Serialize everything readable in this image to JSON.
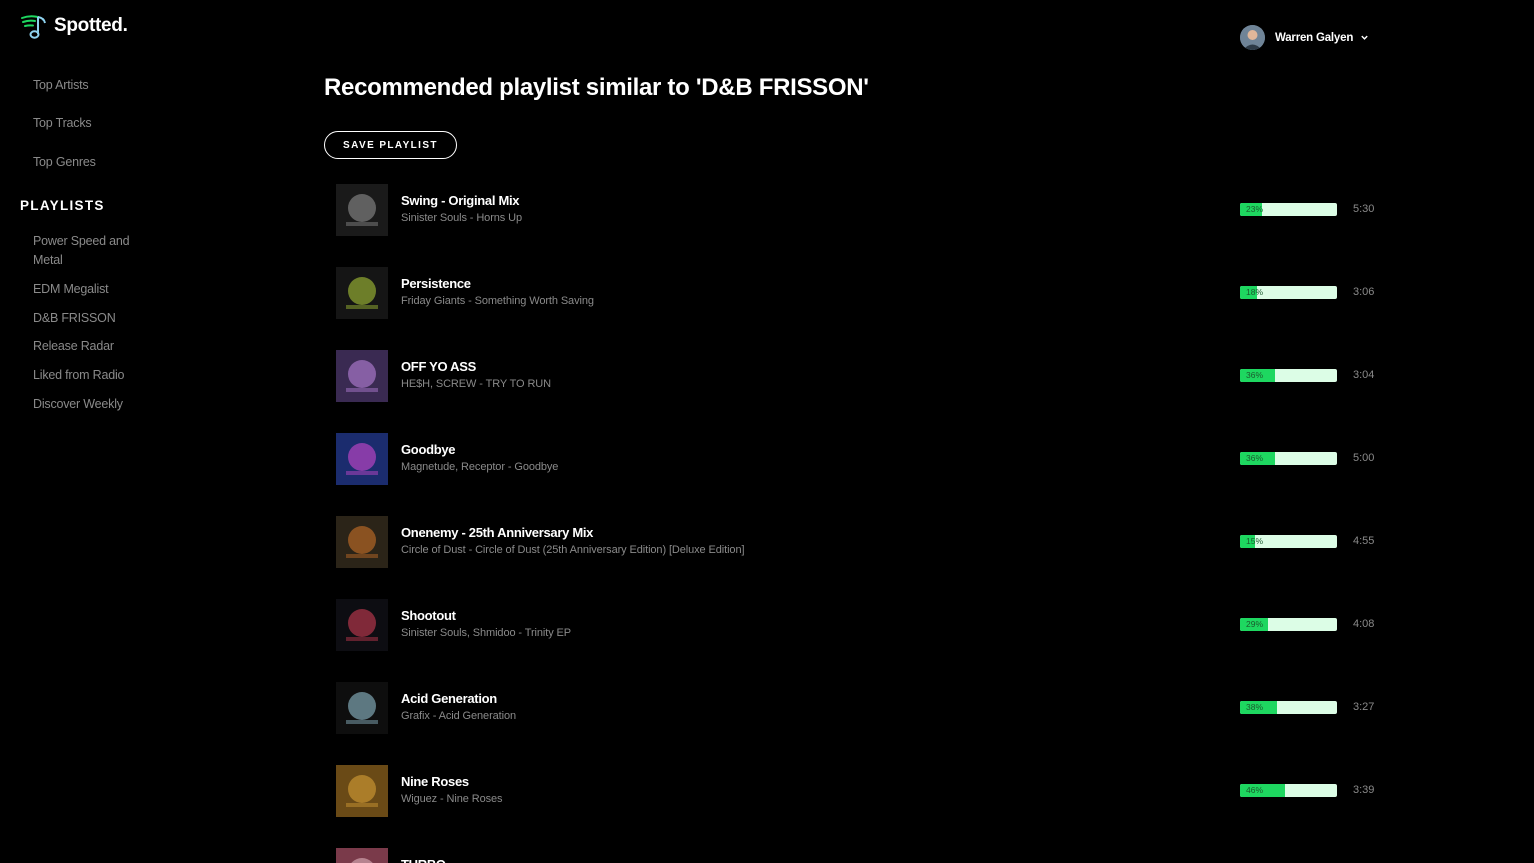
{
  "app": {
    "name": "Spotted."
  },
  "user": {
    "name": "Warren Galyen"
  },
  "sidebar": {
    "links": [
      "Top Artists",
      "Top Tracks",
      "Top Genres"
    ],
    "playlists_heading": "PLAYLISTS",
    "playlists": [
      "Power Speed and Metal",
      "EDM Megalist",
      "D&B FRISSON",
      "Release Radar",
      "Liked from Radio",
      "Discover Weekly"
    ]
  },
  "main": {
    "title": "Recommended playlist similar to 'D&B FRISSON'",
    "save_label": "SAVE PLAYLIST",
    "tracks": [
      {
        "name": "Swing - Original Mix",
        "subtitle": "Sinister Souls - Horns Up",
        "popularity": 23,
        "popularity_label": "23%",
        "duration": "5:30",
        "cover_colors": [
          "#1a1a1a",
          "#9a9a9a"
        ]
      },
      {
        "name": "Persistence",
        "subtitle": "Friday Giants - Something Worth Saving",
        "popularity": 18,
        "popularity_label": "18%",
        "duration": "3:06",
        "cover_colors": [
          "#151515",
          "#b7d63a"
        ]
      },
      {
        "name": "OFF YO ASS",
        "subtitle": "HE$H, SCREW - TRY TO RUN",
        "popularity": 36,
        "popularity_label": "36%",
        "duration": "3:04",
        "cover_colors": [
          "#3a2a52",
          "#c58ae8"
        ]
      },
      {
        "name": "Goodbye",
        "subtitle": "Magnetude, Receptor - Goodbye",
        "popularity": 36,
        "popularity_label": "36%",
        "duration": "5:00",
        "cover_colors": [
          "#1b2c6e",
          "#e04ad8"
        ]
      },
      {
        "name": "Onenemy - 25th Anniversary Mix",
        "subtitle": "Circle of Dust - Circle of Dust (25th Anniversary Edition) [Deluxe Edition]",
        "popularity": 15,
        "popularity_label": "15%",
        "duration": "4:55",
        "cover_colors": [
          "#2b2418",
          "#d9792a"
        ]
      },
      {
        "name": "Shootout",
        "subtitle": "Sinister Souls, Shmidoo - Trinity EP",
        "popularity": 29,
        "popularity_label": "29%",
        "duration": "4:08",
        "cover_colors": [
          "#0d0d12",
          "#e0425a"
        ]
      },
      {
        "name": "Acid Generation",
        "subtitle": "Grafix - Acid Generation",
        "popularity": 38,
        "popularity_label": "38%",
        "duration": "3:27",
        "cover_colors": [
          "#0e0e0e",
          "#9fd0e0"
        ]
      },
      {
        "name": "Nine Roses",
        "subtitle": "Wiguez - Nine Roses",
        "popularity": 46,
        "popularity_label": "46%",
        "duration": "3:39",
        "cover_colors": [
          "#6a4a16",
          "#e0a83a"
        ]
      },
      {
        "name": "TURBO",
        "subtitle": "",
        "popularity": 0,
        "popularity_label": "",
        "duration": "",
        "cover_colors": [
          "#7a3a4a",
          "#e8c0c8"
        ]
      }
    ]
  },
  "colors": {
    "accent": "#1ed760",
    "bar_track": "#dcfde6",
    "muted_text": "#8a8a8a",
    "background": "#000000"
  },
  "icons": {
    "logo": "music-note-icon",
    "dropdown": "chevron-down-icon"
  }
}
